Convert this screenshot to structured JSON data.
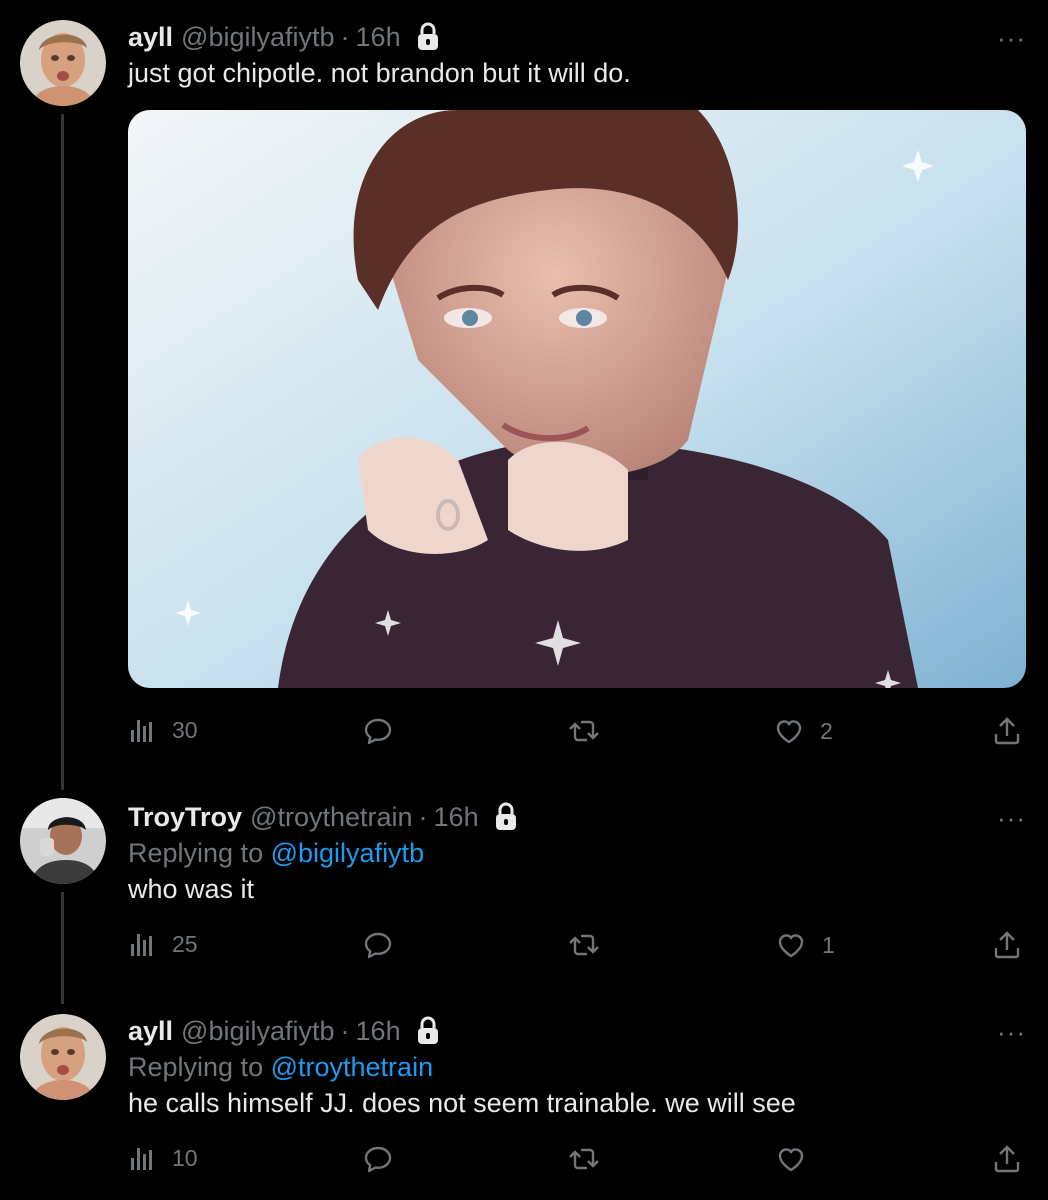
{
  "tweets": [
    {
      "name": "ayll",
      "handle": "@bigilyafiytb",
      "separator": "·",
      "time": "16h",
      "text": "just got chipotle. not brandon but it will do.",
      "views": "30",
      "likes": "2",
      "more": "···"
    },
    {
      "name": "TroyTroy",
      "handle": "@troythetrain",
      "separator": "·",
      "time": "16h",
      "replying_prefix": "Replying to",
      "replying_to": "@bigilyafiytb",
      "text": "who was it",
      "views": "25",
      "likes": "1",
      "more": "···"
    },
    {
      "name": "ayll",
      "handle": "@bigilyafiytb",
      "separator": "·",
      "time": "16h",
      "replying_prefix": "Replying to",
      "replying_to": "@troythetrain",
      "text": "he calls himself JJ. does not seem trainable. we will see",
      "views": "10",
      "more": "···"
    }
  ],
  "icons": {
    "views": "analytics-icon",
    "reply": "reply-icon",
    "retweet": "retweet-icon",
    "like": "heart-icon",
    "share": "share-icon",
    "protected": "lock-icon"
  },
  "colors": {
    "background": "#000000",
    "text": "#e7e9ea",
    "muted": "#71767b",
    "link": "#1d9bf0",
    "thread_line": "#333639"
  }
}
